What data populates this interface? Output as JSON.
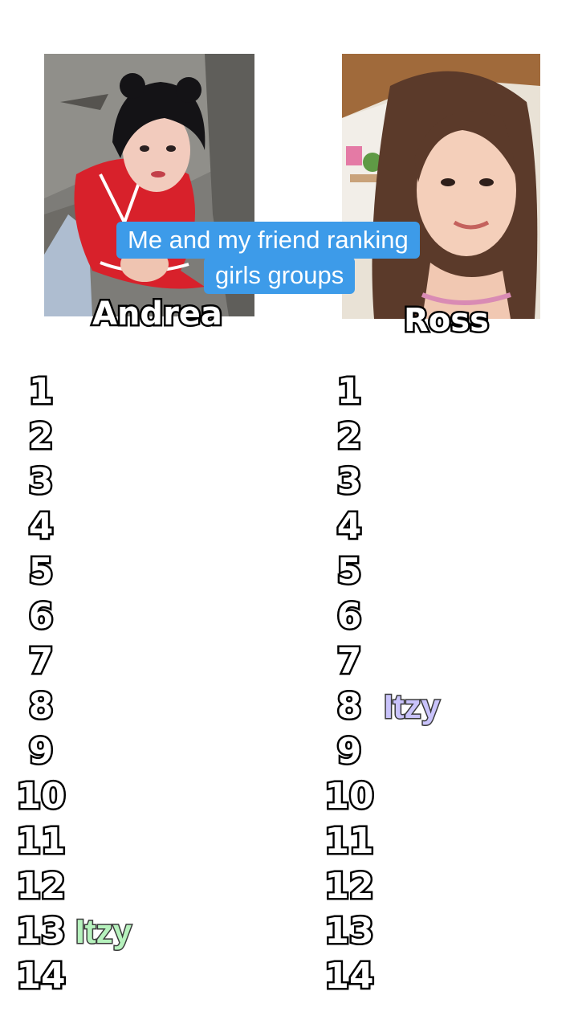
{
  "caption": {
    "line1": "Me and my friend ranking",
    "line2": "girls groups"
  },
  "players": [
    {
      "name": "Andrea",
      "accent": "#b6f2bd"
    },
    {
      "name": "Ross",
      "accent": "#c9c3fb"
    }
  ],
  "ranks": [
    "1",
    "2",
    "3",
    "4",
    "5",
    "6",
    "7",
    "8",
    "9",
    "10",
    "11",
    "12",
    "13",
    "14"
  ],
  "left_entries": [
    "",
    "",
    "",
    "",
    "",
    "",
    "",
    "",
    "",
    "",
    "",
    "",
    "Itzy",
    ""
  ],
  "right_entries": [
    "",
    "",
    "",
    "",
    "",
    "",
    "",
    "Itzy",
    "",
    "",
    "",
    "",
    "",
    ""
  ]
}
